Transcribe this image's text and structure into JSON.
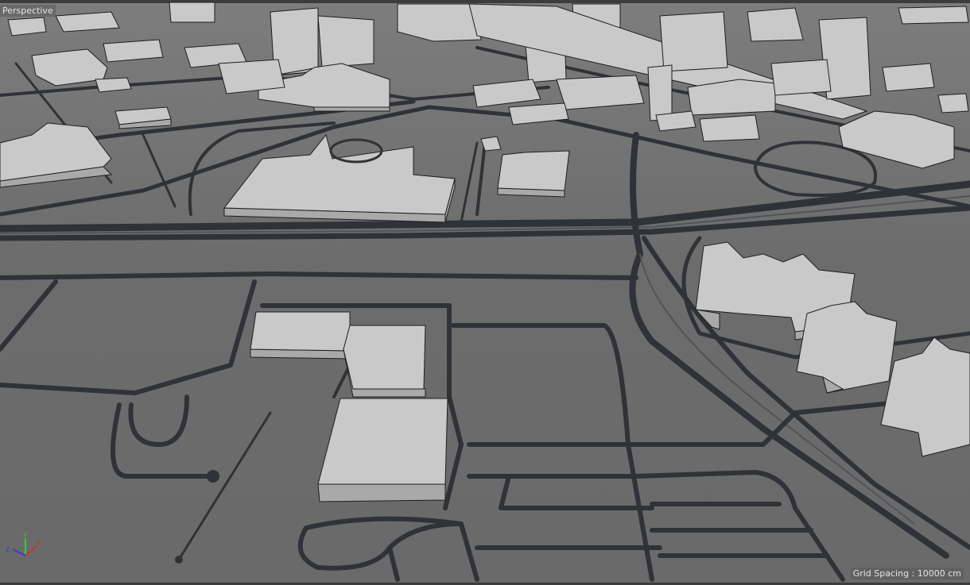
{
  "viewport": {
    "view_name": "Perspective",
    "grid_spacing": "Grid Spacing : 10000 cm",
    "axis_labels": {
      "x": "X",
      "y": "Y",
      "z": "Z"
    }
  },
  "colors": {
    "ground": "#6f6f6f",
    "road": "#2f3236",
    "building": "#c9c9c9",
    "axis_x": "#c0392b",
    "axis_y": "#2ecc40",
    "axis_z": "#3b3bd0"
  }
}
